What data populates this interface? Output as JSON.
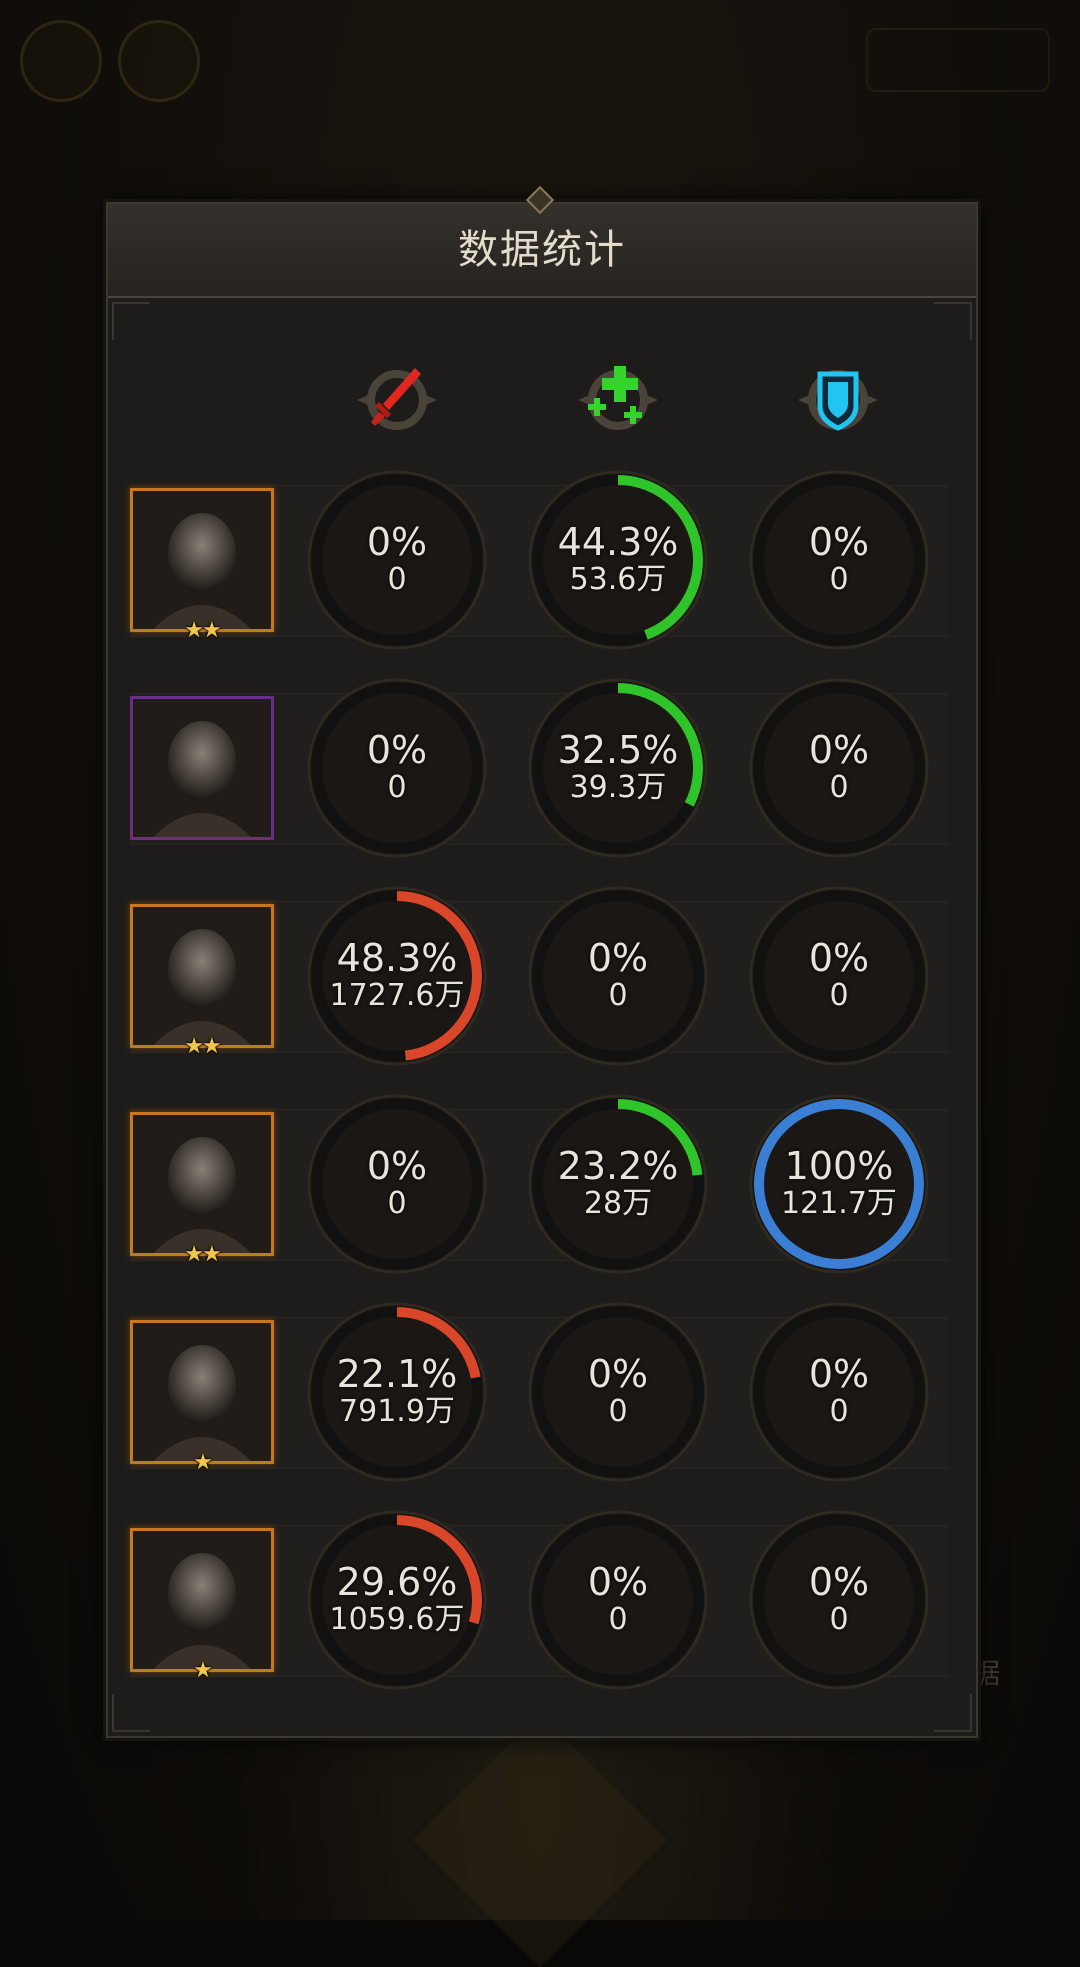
{
  "title": "数据统计",
  "colors": {
    "damage": "#d9462a",
    "heal": "#2ec42a",
    "shield": "#3b7fd4"
  },
  "columns": [
    {
      "key": "damage",
      "icon": "sword-icon"
    },
    {
      "key": "heal",
      "icon": "heal-plus-icon"
    },
    {
      "key": "shield",
      "icon": "shield-icon"
    }
  ],
  "heroes": [
    {
      "frame": "gold",
      "stars": "★★",
      "stats": [
        {
          "pct": "0%",
          "val": "0",
          "ratio": 0
        },
        {
          "pct": "44.3%",
          "val": "53.6万",
          "ratio": 0.443
        },
        {
          "pct": "0%",
          "val": "0",
          "ratio": 0
        }
      ]
    },
    {
      "frame": "purple",
      "stars": "",
      "stats": [
        {
          "pct": "0%",
          "val": "0",
          "ratio": 0
        },
        {
          "pct": "32.5%",
          "val": "39.3万",
          "ratio": 0.325
        },
        {
          "pct": "0%",
          "val": "0",
          "ratio": 0
        }
      ]
    },
    {
      "frame": "gold",
      "stars": "★★",
      "stats": [
        {
          "pct": "48.3%",
          "val": "1727.6万",
          "ratio": 0.483
        },
        {
          "pct": "0%",
          "val": "0",
          "ratio": 0
        },
        {
          "pct": "0%",
          "val": "0",
          "ratio": 0
        }
      ]
    },
    {
      "frame": "gold",
      "stars": "★★",
      "stats": [
        {
          "pct": "0%",
          "val": "0",
          "ratio": 0
        },
        {
          "pct": "23.2%",
          "val": "28万",
          "ratio": 0.232
        },
        {
          "pct": "100%",
          "val": "121.7万",
          "ratio": 1
        }
      ]
    },
    {
      "frame": "gold",
      "stars": "★",
      "stats": [
        {
          "pct": "22.1%",
          "val": "791.9万",
          "ratio": 0.221
        },
        {
          "pct": "0%",
          "val": "0",
          "ratio": 0
        },
        {
          "pct": "0%",
          "val": "0",
          "ratio": 0
        }
      ]
    },
    {
      "frame": "gold",
      "stars": "★",
      "stats": [
        {
          "pct": "29.6%",
          "val": "1059.6万",
          "ratio": 0.296
        },
        {
          "pct": "0%",
          "val": "0",
          "ratio": 0
        },
        {
          "pct": "0%",
          "val": "0",
          "ratio": 0
        }
      ]
    }
  ],
  "background": {
    "side_label": "据"
  }
}
